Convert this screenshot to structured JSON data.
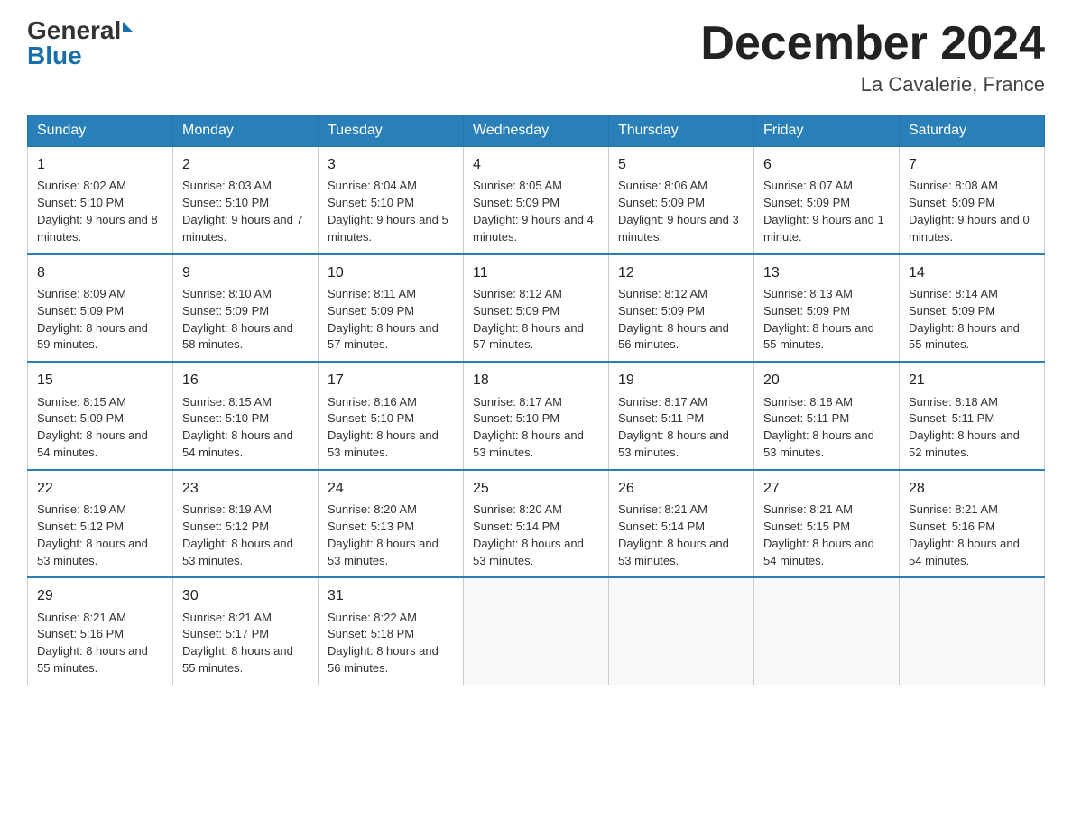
{
  "logo": {
    "general": "General",
    "blue": "Blue"
  },
  "title": "December 2024",
  "location": "La Cavalerie, France",
  "days_header": [
    "Sunday",
    "Monday",
    "Tuesday",
    "Wednesday",
    "Thursday",
    "Friday",
    "Saturday"
  ],
  "weeks": [
    [
      {
        "day": "1",
        "sunrise": "8:02 AM",
        "sunset": "5:10 PM",
        "daylight": "9 hours and 8 minutes."
      },
      {
        "day": "2",
        "sunrise": "8:03 AM",
        "sunset": "5:10 PM",
        "daylight": "9 hours and 7 minutes."
      },
      {
        "day": "3",
        "sunrise": "8:04 AM",
        "sunset": "5:10 PM",
        "daylight": "9 hours and 5 minutes."
      },
      {
        "day": "4",
        "sunrise": "8:05 AM",
        "sunset": "5:09 PM",
        "daylight": "9 hours and 4 minutes."
      },
      {
        "day": "5",
        "sunrise": "8:06 AM",
        "sunset": "5:09 PM",
        "daylight": "9 hours and 3 minutes."
      },
      {
        "day": "6",
        "sunrise": "8:07 AM",
        "sunset": "5:09 PM",
        "daylight": "9 hours and 1 minute."
      },
      {
        "day": "7",
        "sunrise": "8:08 AM",
        "sunset": "5:09 PM",
        "daylight": "9 hours and 0 minutes."
      }
    ],
    [
      {
        "day": "8",
        "sunrise": "8:09 AM",
        "sunset": "5:09 PM",
        "daylight": "8 hours and 59 minutes."
      },
      {
        "day": "9",
        "sunrise": "8:10 AM",
        "sunset": "5:09 PM",
        "daylight": "8 hours and 58 minutes."
      },
      {
        "day": "10",
        "sunrise": "8:11 AM",
        "sunset": "5:09 PM",
        "daylight": "8 hours and 57 minutes."
      },
      {
        "day": "11",
        "sunrise": "8:12 AM",
        "sunset": "5:09 PM",
        "daylight": "8 hours and 57 minutes."
      },
      {
        "day": "12",
        "sunrise": "8:12 AM",
        "sunset": "5:09 PM",
        "daylight": "8 hours and 56 minutes."
      },
      {
        "day": "13",
        "sunrise": "8:13 AM",
        "sunset": "5:09 PM",
        "daylight": "8 hours and 55 minutes."
      },
      {
        "day": "14",
        "sunrise": "8:14 AM",
        "sunset": "5:09 PM",
        "daylight": "8 hours and 55 minutes."
      }
    ],
    [
      {
        "day": "15",
        "sunrise": "8:15 AM",
        "sunset": "5:09 PM",
        "daylight": "8 hours and 54 minutes."
      },
      {
        "day": "16",
        "sunrise": "8:15 AM",
        "sunset": "5:10 PM",
        "daylight": "8 hours and 54 minutes."
      },
      {
        "day": "17",
        "sunrise": "8:16 AM",
        "sunset": "5:10 PM",
        "daylight": "8 hours and 53 minutes."
      },
      {
        "day": "18",
        "sunrise": "8:17 AM",
        "sunset": "5:10 PM",
        "daylight": "8 hours and 53 minutes."
      },
      {
        "day": "19",
        "sunrise": "8:17 AM",
        "sunset": "5:11 PM",
        "daylight": "8 hours and 53 minutes."
      },
      {
        "day": "20",
        "sunrise": "8:18 AM",
        "sunset": "5:11 PM",
        "daylight": "8 hours and 53 minutes."
      },
      {
        "day": "21",
        "sunrise": "8:18 AM",
        "sunset": "5:11 PM",
        "daylight": "8 hours and 52 minutes."
      }
    ],
    [
      {
        "day": "22",
        "sunrise": "8:19 AM",
        "sunset": "5:12 PM",
        "daylight": "8 hours and 53 minutes."
      },
      {
        "day": "23",
        "sunrise": "8:19 AM",
        "sunset": "5:12 PM",
        "daylight": "8 hours and 53 minutes."
      },
      {
        "day": "24",
        "sunrise": "8:20 AM",
        "sunset": "5:13 PM",
        "daylight": "8 hours and 53 minutes."
      },
      {
        "day": "25",
        "sunrise": "8:20 AM",
        "sunset": "5:14 PM",
        "daylight": "8 hours and 53 minutes."
      },
      {
        "day": "26",
        "sunrise": "8:21 AM",
        "sunset": "5:14 PM",
        "daylight": "8 hours and 53 minutes."
      },
      {
        "day": "27",
        "sunrise": "8:21 AM",
        "sunset": "5:15 PM",
        "daylight": "8 hours and 54 minutes."
      },
      {
        "day": "28",
        "sunrise": "8:21 AM",
        "sunset": "5:16 PM",
        "daylight": "8 hours and 54 minutes."
      }
    ],
    [
      {
        "day": "29",
        "sunrise": "8:21 AM",
        "sunset": "5:16 PM",
        "daylight": "8 hours and 55 minutes."
      },
      {
        "day": "30",
        "sunrise": "8:21 AM",
        "sunset": "5:17 PM",
        "daylight": "8 hours and 55 minutes."
      },
      {
        "day": "31",
        "sunrise": "8:22 AM",
        "sunset": "5:18 PM",
        "daylight": "8 hours and 56 minutes."
      },
      null,
      null,
      null,
      null
    ]
  ]
}
